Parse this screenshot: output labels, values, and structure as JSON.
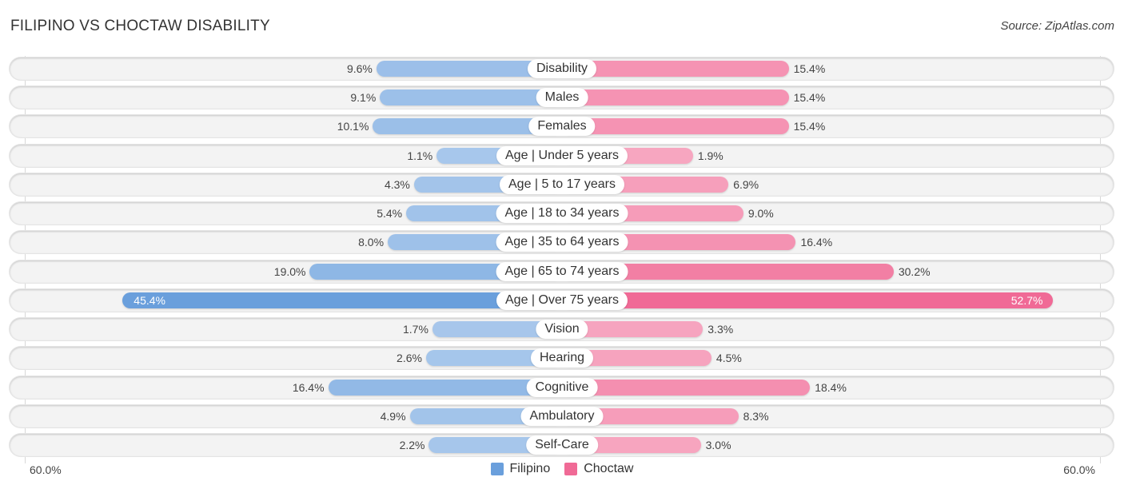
{
  "header": {
    "title": "FILIPINO VS CHOCTAW DISABILITY",
    "source": "Source: ZipAtlas.com"
  },
  "chart_data": {
    "type": "bar",
    "orientation": "horizontal-diverging",
    "title": "FILIPINO VS CHOCTAW DISABILITY",
    "categories": [
      "Disability",
      "Males",
      "Females",
      "Age | Under 5 years",
      "Age | 5 to 17 years",
      "Age | 18 to 34 years",
      "Age | 35 to 64 years",
      "Age | 65 to 74 years",
      "Age | Over 75 years",
      "Vision",
      "Hearing",
      "Cognitive",
      "Ambulatory",
      "Self-Care"
    ],
    "series": [
      {
        "name": "Filipino",
        "color": "#6a9fdc",
        "side": "left",
        "values": [
          9.6,
          9.1,
          10.1,
          1.1,
          4.3,
          5.4,
          8.0,
          19.0,
          45.4,
          1.7,
          2.6,
          16.4,
          4.9,
          2.2
        ]
      },
      {
        "name": "Choctaw",
        "color": "#f06a96",
        "side": "right",
        "values": [
          15.4,
          15.4,
          15.4,
          1.9,
          6.9,
          9.0,
          16.4,
          30.2,
          52.7,
          3.3,
          4.5,
          18.4,
          8.3,
          3.0
        ]
      }
    ],
    "axis": {
      "left_label": "60.0%",
      "right_label": "60.0%",
      "max": 60.0
    },
    "unit": "%",
    "legend": {
      "position": "bottom-center",
      "items": [
        "Filipino",
        "Choctaw"
      ]
    },
    "grid": false
  }
}
